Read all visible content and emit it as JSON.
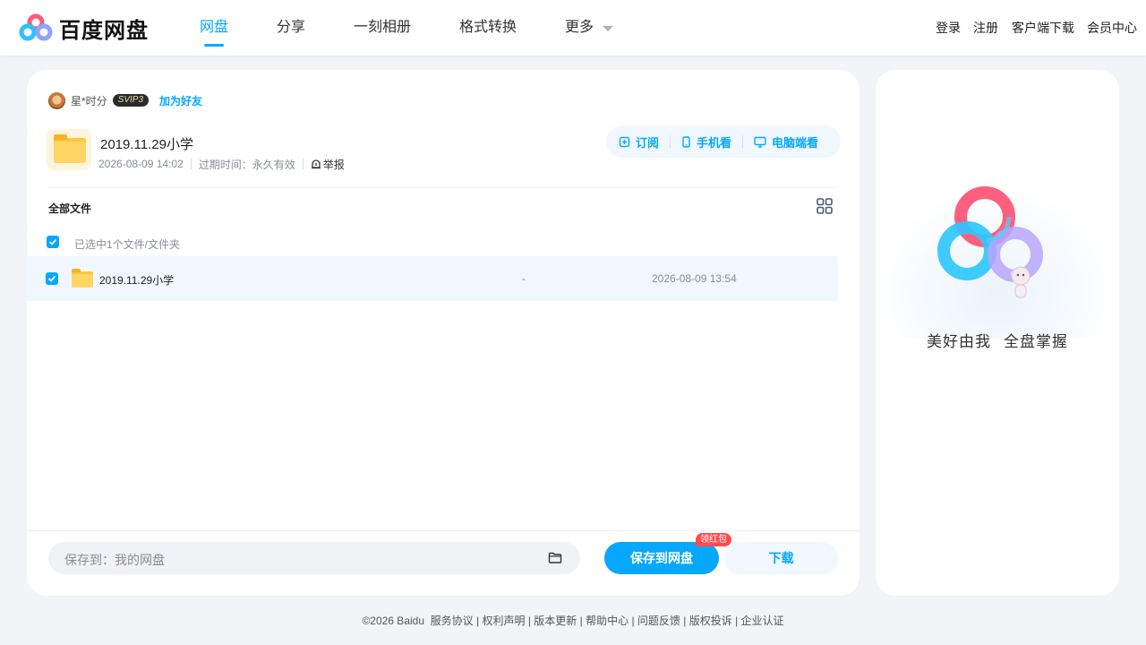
{
  "header": {
    "logo_text": "百度网盘",
    "nav": [
      {
        "label": "网盘",
        "active": true
      },
      {
        "label": "分享",
        "active": false
      },
      {
        "label": "一刻相册",
        "active": false
      },
      {
        "label": "格式转换",
        "active": false
      },
      {
        "label": "更多",
        "active": false
      }
    ],
    "links": [
      "登录",
      "注册",
      "客户端下载",
      "会员中心"
    ]
  },
  "share": {
    "sharer_name": "星*时分",
    "vip_badge": "SVIP3",
    "add_friend": "加为好友",
    "title": "2019.11.29小学",
    "created": "2026-08-09 14:02",
    "expire": "过期时间：永久有效",
    "report": "举报",
    "actions": [
      "订阅",
      "手机看",
      "电脑端看"
    ]
  },
  "file_list": {
    "header": "全部文件",
    "selected_text": "已选中1个文件/文件夹",
    "rows": [
      {
        "name": "2019.11.29小学",
        "size": "-",
        "date": "2026-08-09 13:54",
        "checked": true
      }
    ]
  },
  "bottom_bar": {
    "save_path_label": "保存到：我的网盘",
    "save_button": "保存到网盘",
    "badge": "领红包",
    "download_button": "下载"
  },
  "side": {
    "slogan_1": "美好由我",
    "slogan_2": "全盘掌握"
  },
  "footer": {
    "copyright": "©2026 Baidu",
    "links": [
      "服务协议",
      "权利声明",
      "版本更新",
      "帮助中心",
      "问题反馈",
      "版权投诉",
      "企业认证"
    ]
  },
  "colors": {
    "accent": "#06a7ff",
    "background": "#f2f4f7",
    "badge_red": "#ff4d4f"
  },
  "icons": [
    "baidu-netdisk-logo",
    "subscribe-icon",
    "phone-icon",
    "monitor-icon",
    "report-icon",
    "grid-view-icon",
    "folder-icon",
    "checkbox-icon"
  ]
}
